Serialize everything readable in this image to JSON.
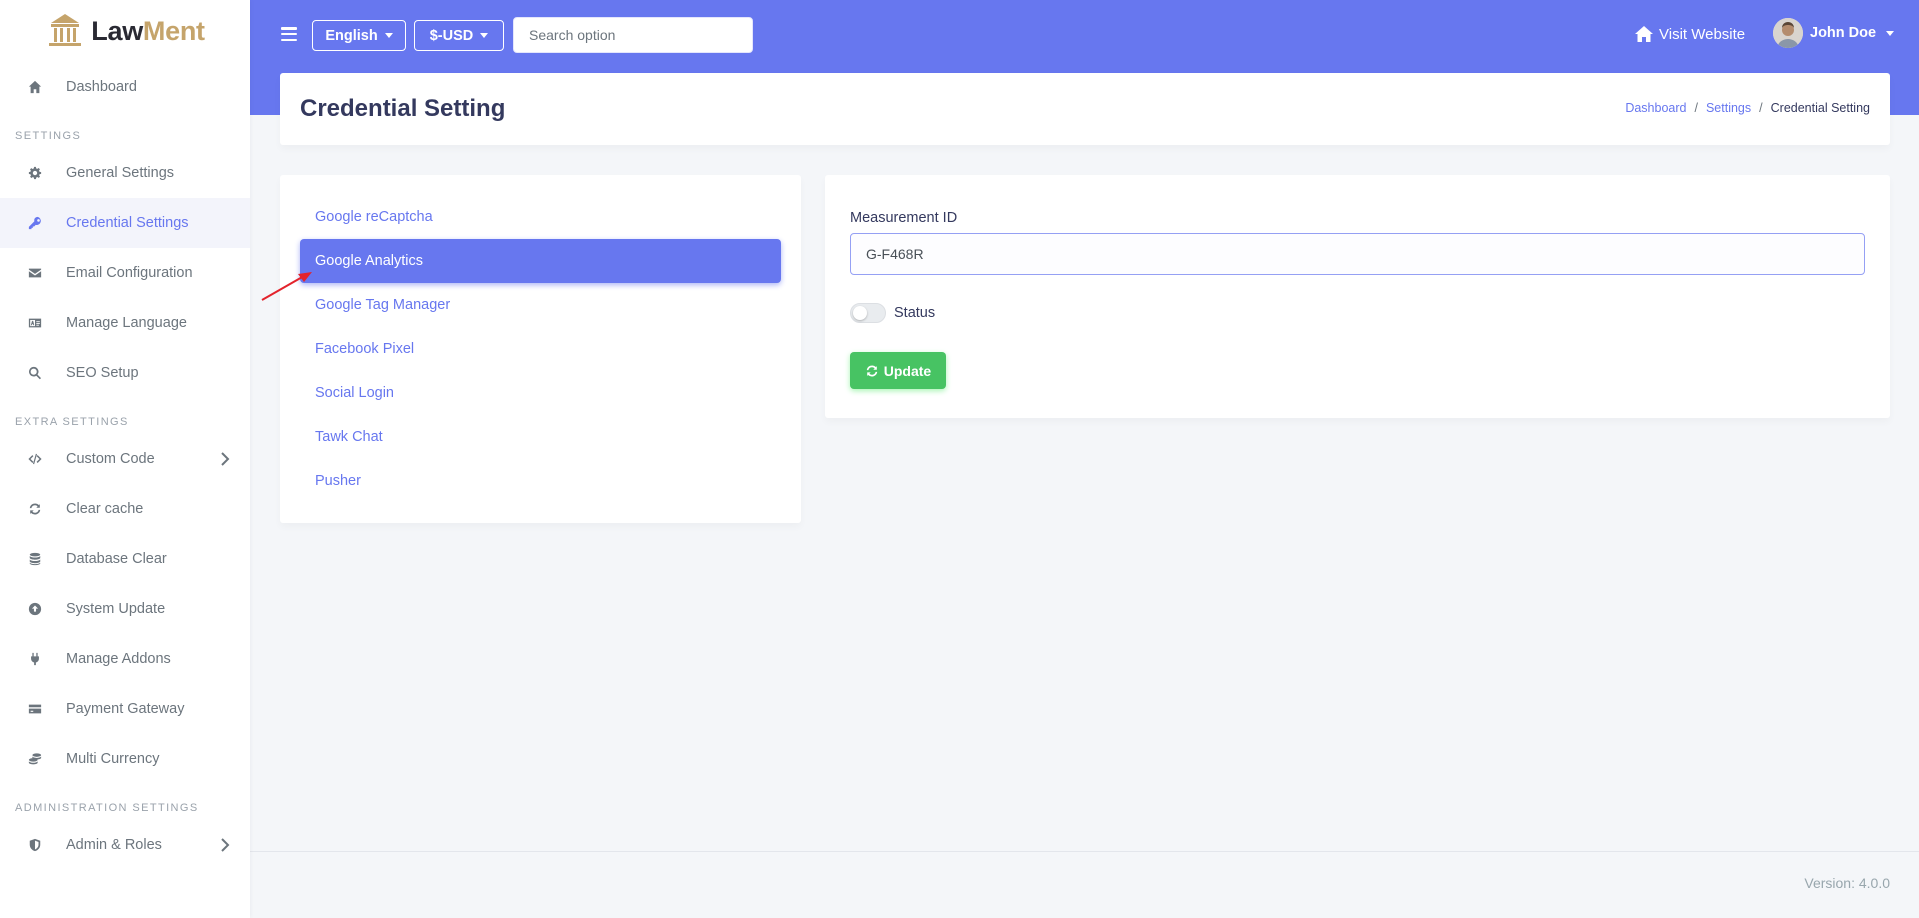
{
  "brand": {
    "part1": "Law",
    "part2": "Ment",
    "accent": "#c5a46b"
  },
  "colors": {
    "primary": "#6777ef",
    "success": "#47c363"
  },
  "sidebar": {
    "dashboard": "Dashboard",
    "sections": {
      "settings": "SETTINGS",
      "extra": "EXTRA SETTINGS",
      "admin": "ADMINISTRATION SETTINGS"
    },
    "items": [
      {
        "label": "General Settings",
        "icon": "gear-icon"
      },
      {
        "label": "Credential Settings",
        "icon": "key-icon"
      },
      {
        "label": "Email Configuration",
        "icon": "envelope-icon"
      },
      {
        "label": "Manage Language",
        "icon": "language-icon"
      },
      {
        "label": "SEO Setup",
        "icon": "search-icon"
      },
      {
        "label": "Custom Code",
        "icon": "code-icon"
      },
      {
        "label": "Clear cache",
        "icon": "refresh-icon"
      },
      {
        "label": "Database Clear",
        "icon": "database-icon"
      },
      {
        "label": "System Update",
        "icon": "upload-circle-icon"
      },
      {
        "label": "Manage Addons",
        "icon": "plug-icon"
      },
      {
        "label": "Payment Gateway",
        "icon": "credit-card-icon"
      },
      {
        "label": "Multi Currency",
        "icon": "coins-icon"
      },
      {
        "label": "Admin & Roles",
        "icon": "shield-icon"
      }
    ]
  },
  "topbar": {
    "language": "English",
    "currency": "$-USD",
    "search_placeholder": "Search option",
    "visit_website": "Visit Website",
    "user_name": "John Doe"
  },
  "page": {
    "title": "Credential Setting",
    "breadcrumb": [
      "Dashboard",
      "Settings",
      "Credential Setting"
    ]
  },
  "tabs": [
    "Google reCaptcha",
    "Google Analytics",
    "Google Tag Manager",
    "Facebook Pixel",
    "Social Login",
    "Tawk Chat",
    "Pusher"
  ],
  "active_tab": "Google Analytics",
  "form": {
    "label": "Measurement ID",
    "value": "G-F468R",
    "status_label": "Status",
    "status_on": false,
    "update_label": "Update"
  },
  "footer": {
    "version": "Version: 4.0.0"
  }
}
